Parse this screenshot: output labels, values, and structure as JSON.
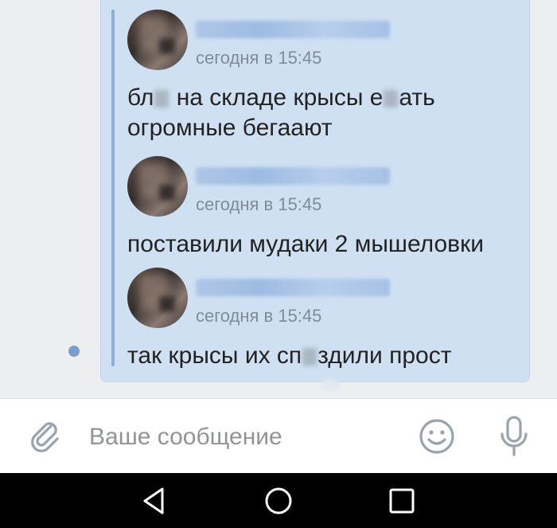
{
  "messages": [
    {
      "timestamp": "сегодня в 15:45",
      "text_parts": [
        "бл",
        "на складе крысы е",
        "ать",
        "огромные бегаают"
      ]
    },
    {
      "timestamp": "сегодня в 15:45",
      "text": "поставили мудаки 2 мышеловки"
    },
    {
      "timestamp": "сегодня в 15:45",
      "text_parts": [
        "так крысы их сп",
        "здили прост"
      ]
    }
  ],
  "composer": {
    "placeholder": "Ваше сообщение"
  },
  "icons": {
    "attach": "paperclip-icon",
    "emoji": "smiley-icon",
    "mic": "microphone-icon",
    "nav_back": "triangle-back-icon",
    "nav_home": "circle-home-icon",
    "nav_recent": "square-recents-icon"
  },
  "colors": {
    "bubble": "#cfe0f3",
    "quote_bar": "#8fb1d9",
    "unread_dot": "#7a9ed0",
    "timestamp": "#7f8b98",
    "placeholder": "#8e949a",
    "icon_gray": "#99a2ad"
  }
}
